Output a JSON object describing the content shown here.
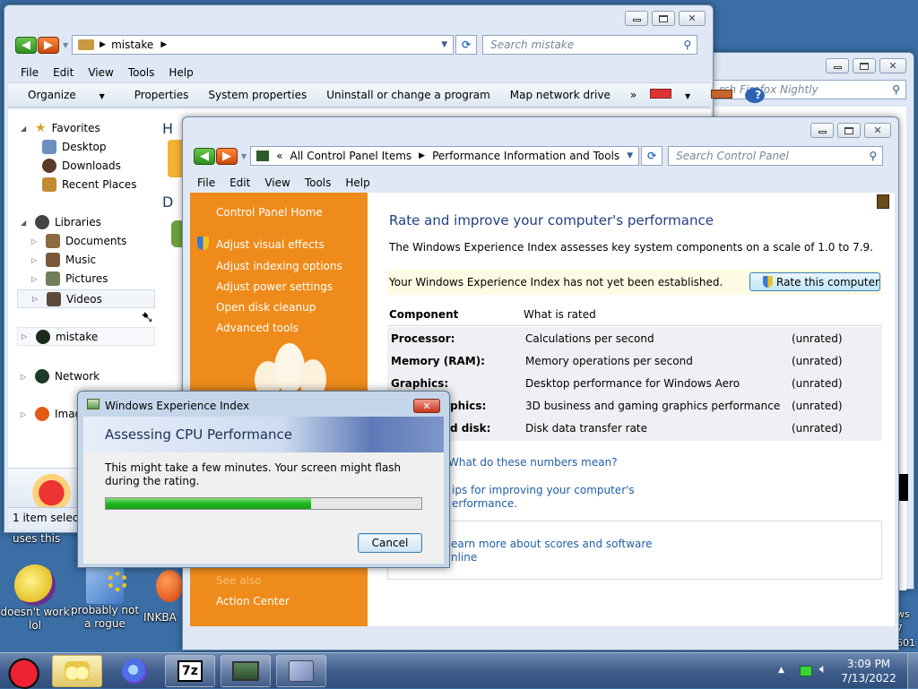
{
  "desktop": {
    "icons": [
      {
        "label_line1": "doesn't work",
        "label_line2": "lol"
      },
      {
        "label_line1": "probably not",
        "label_line2": "a rogue"
      },
      {
        "label_line1": "INKBA",
        "label_line2": ""
      }
    ],
    "partial_text_top": "uses this",
    "watermark_lines": [
      "ws 7",
      "601",
      "line"
    ]
  },
  "explorer_back": {
    "search_placeholder": "rch Firefox Nightly"
  },
  "explorer": {
    "address_path": "mistake",
    "search_placeholder": "Search mistake",
    "menu": [
      "File",
      "Edit",
      "View",
      "Tools",
      "Help"
    ],
    "toolbar": [
      "Organize",
      "Properties",
      "System properties",
      "Uninstall or change a program",
      "Map network drive",
      "»"
    ],
    "nav": {
      "favorites": "Favorites",
      "desktop": "Desktop",
      "downloads": "Downloads",
      "recent": "Recent Places",
      "libraries": "Libraries",
      "documents": "Documents",
      "music": "Music",
      "pictures": "Pictures",
      "videos": "Videos",
      "mistake": "mistake",
      "network": "Network",
      "image": "Image"
    },
    "content_partial_h": "H",
    "content_partial_d": "D",
    "status": "1 item selecte"
  },
  "control_panel": {
    "address": {
      "prefix": "«",
      "item1": "All Control Panel Items",
      "item2": "Performance Information and Tools"
    },
    "search_placeholder": "Search Control Panel",
    "menu": [
      "File",
      "Edit",
      "View",
      "Tools",
      "Help"
    ],
    "sidebar": {
      "home": "Control Panel Home",
      "links": [
        "Adjust visual effects",
        "Adjust indexing options",
        "Adjust power settings",
        "Open disk cleanup",
        "Advanced tools"
      ],
      "see_also": "See also",
      "action_center": "Action Center"
    },
    "heading": "Rate and improve your computer's performance",
    "description": "The Windows Experience Index assesses key system components on a scale of 1.0 to 7.9.",
    "notice": "Your Windows Experience Index has not yet been established.",
    "rate_button": "Rate this computer",
    "table": {
      "headers": [
        "Component",
        "What is rated"
      ],
      "rows": [
        {
          "component": "Processor:",
          "what": "Calculations per second",
          "score": "(unrated)"
        },
        {
          "component": "Memory (RAM):",
          "what": "Memory operations per second",
          "score": "(unrated)"
        },
        {
          "component": "Graphics:",
          "what": "Desktop performance for Windows Aero",
          "score": "(unrated)"
        },
        {
          "component": "phics:",
          "what": "3D business and gaming graphics performance",
          "score": "(unrated)"
        },
        {
          "component": "d disk:",
          "what": "Disk data transfer rate",
          "score": "(unrated)"
        }
      ]
    },
    "links": {
      "numbers": "What do these numbers mean?",
      "tips_1": "ips for improving your computer's",
      "tips_2": "erformance.",
      "learn_1": "earn more about scores and software",
      "learn_2": "nline"
    }
  },
  "dialog": {
    "title": "Windows Experience Index",
    "banner": "Assessing CPU Performance",
    "message_1": "This might take a few minutes. Your screen might flash",
    "message_2": "during the rating.",
    "progress": 0.65,
    "cancel": "Cancel"
  },
  "taskbar": {
    "time": "3:09 PM",
    "date": "7/13/2022"
  }
}
